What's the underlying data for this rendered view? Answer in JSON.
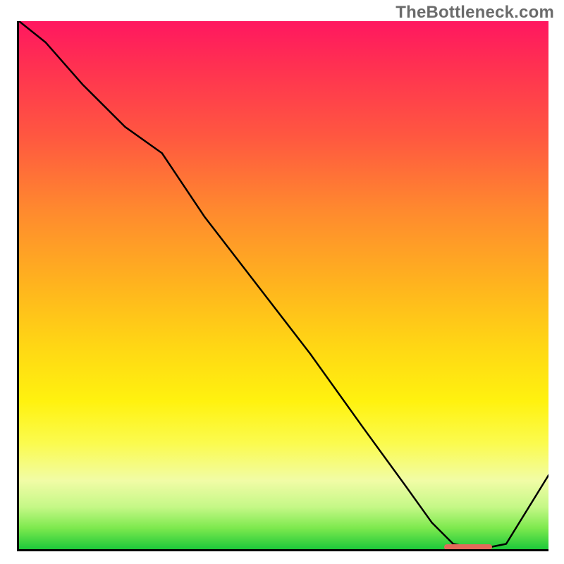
{
  "watermark": "TheBottleneck.com",
  "colors": {
    "gradient_top": "#ff1760",
    "gradient_bottom": "#1dc93a",
    "axis": "#000000",
    "curve": "#000000",
    "marker": "#e36a5a"
  },
  "chart_data": {
    "type": "line",
    "title": "",
    "xlabel": "",
    "ylabel": "",
    "xlim": [
      0,
      100
    ],
    "ylim": [
      0,
      100
    ],
    "x": [
      0,
      5,
      12,
      20,
      27,
      35,
      45,
      55,
      65,
      73,
      78,
      82,
      87,
      92,
      100
    ],
    "values": [
      100,
      96,
      88,
      80,
      75,
      63,
      50,
      37,
      23,
      12,
      5,
      1,
      0,
      1,
      14
    ],
    "marker": {
      "x_start": 80,
      "x_end": 89,
      "y": 0.8
    },
    "notes": "Curve descends from top-left, slight knee ~x=27, straightens, reaches minimum ~x=85 at y≈0, then rises toward x=100."
  }
}
